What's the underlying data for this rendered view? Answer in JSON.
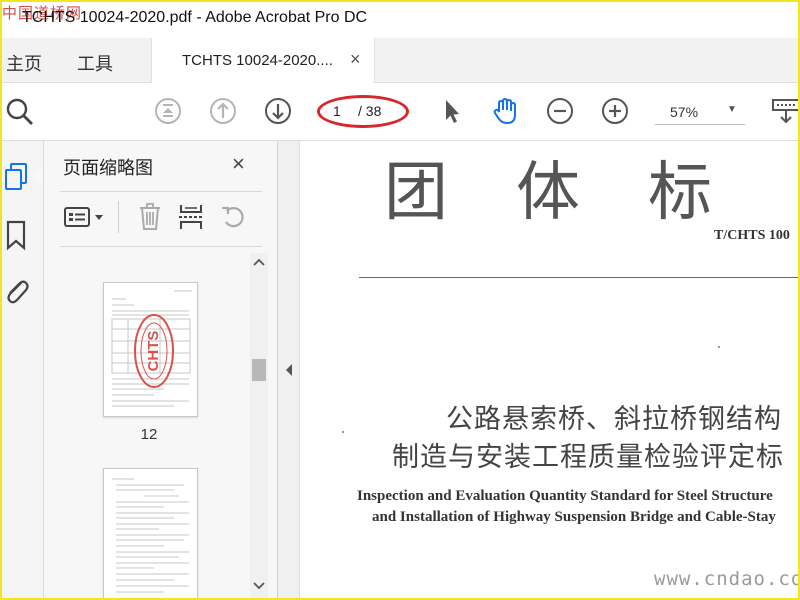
{
  "window": {
    "title": "TCHTS 10024-2020.pdf - Adobe Acrobat Pro DC",
    "watermark": "中国道桥网"
  },
  "nav_tabs": {
    "home": "主页",
    "tools": "工具"
  },
  "document_tab": {
    "label": "TCHTS 10024-2020....",
    "close": "×"
  },
  "toolbar": {
    "current_page": "1",
    "total_pages": "/ 38",
    "zoom": "57%",
    "icons": [
      "search-icon",
      "first-page-icon",
      "previous-page-icon",
      "next-page-icon",
      "select-cursor-icon",
      "hand-tool-icon",
      "zoom-out-icon",
      "zoom-in-icon",
      "scroll-mode-icon"
    ],
    "highlight_color": "#d8262a",
    "active_tool_color": "#1473e6"
  },
  "sidebar": {
    "icons": [
      "page-thumbnails-icon",
      "bookmarks-icon",
      "attachments-icon"
    ],
    "active_color": "#1473e6"
  },
  "thumbnails_panel": {
    "title": "页面缩略图",
    "close": "×",
    "pages": [
      "12"
    ],
    "stamp_text": "CHTS"
  },
  "document": {
    "heading": "团体标",
    "code": "T/CHTS 100",
    "title_cn_line1": "公路悬索桥、斜拉桥钢结构",
    "title_cn_line2": "制造与安装工程质量检验评定标",
    "title_en_line1": "Inspection and Evaluation Quantity Standard for Steel Structure",
    "title_en_line2": "and Installation of Highway Suspension Bridge and Cable-Stay"
  },
  "website_watermark": "www.cndao.com"
}
